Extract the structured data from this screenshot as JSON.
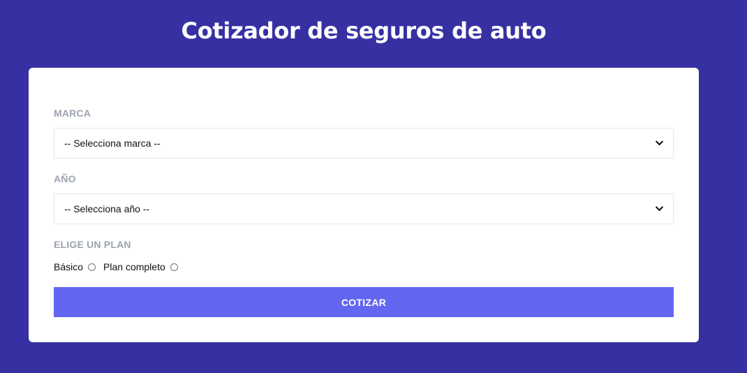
{
  "header": {
    "title": "Cotizador de seguros de auto"
  },
  "form": {
    "brand": {
      "label": "MARCA",
      "selected": "-- Selecciona marca --"
    },
    "year": {
      "label": "AÑO",
      "selected": "-- Selecciona año --"
    },
    "plan": {
      "label": "ELIGE UN PLAN",
      "options": [
        {
          "label": "Básico",
          "checked": false
        },
        {
          "label": "Plan completo",
          "checked": false
        }
      ]
    },
    "submit_label": "COTIZAR"
  },
  "colors": {
    "background": "#3730a3",
    "card": "#ffffff",
    "label": "#9ca3af",
    "button": "#6366f1"
  },
  "icons": {
    "select_arrow": "chevron-down-icon"
  }
}
